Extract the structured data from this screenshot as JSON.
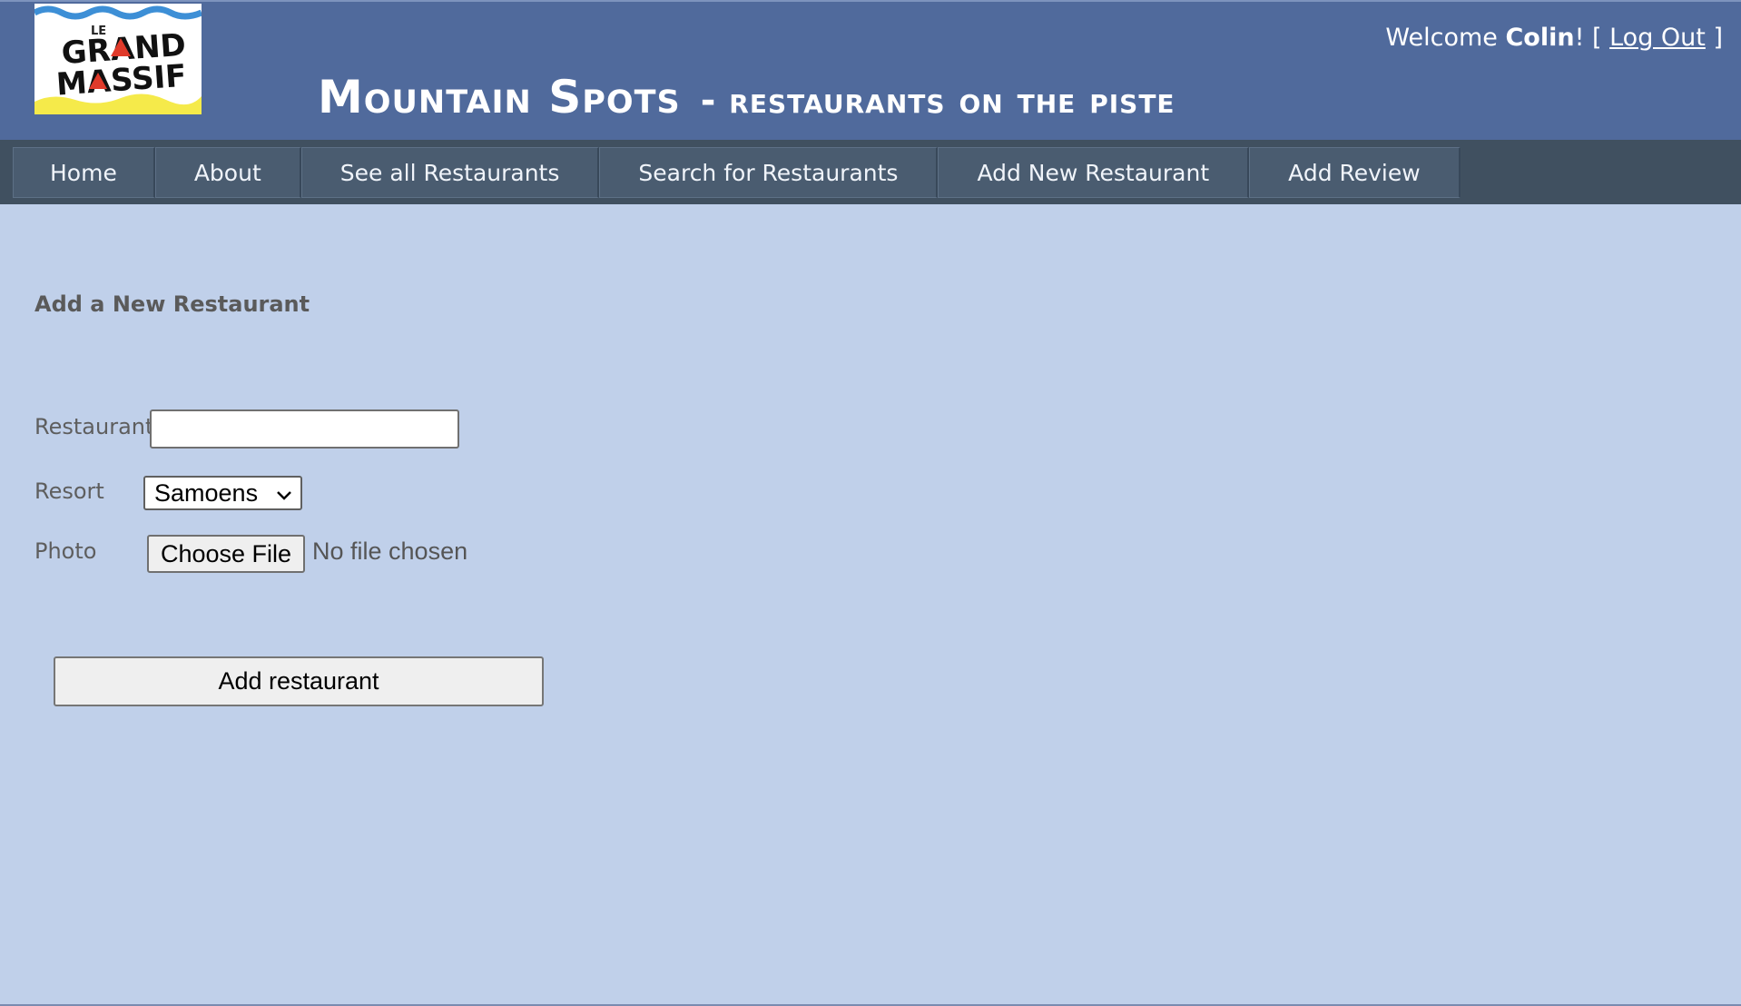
{
  "header": {
    "logo_text": [
      "LE",
      "GRAND",
      "MASSIF"
    ],
    "title_main": "Mountain Spots",
    "title_sep": "-",
    "title_sub": "restaurants on the piste",
    "welcome_prefix": "Welcome ",
    "user_name": "Colin",
    "welcome_suffix": "! [ ",
    "logout_label": "Log Out",
    "welcome_close": " ]"
  },
  "nav": {
    "items": [
      {
        "label": "Home"
      },
      {
        "label": "About"
      },
      {
        "label": "See all Restaurants"
      },
      {
        "label": "Search for Restaurants"
      },
      {
        "label": "Add New Restaurant"
      },
      {
        "label": "Add Review"
      }
    ]
  },
  "form": {
    "heading": "Add a New Restaurant",
    "restaurant_label": "Restaurant",
    "restaurant_value": "",
    "resort_label": "Resort",
    "resort_selected": "Samoens",
    "photo_label": "Photo",
    "file_button_label": "Choose File",
    "file_status": "No file chosen",
    "submit_label": "Add restaurant"
  },
  "colors": {
    "header_bg": "#506a9c",
    "nav_bg": "#405060",
    "page_bg": "#c0d0ea"
  }
}
